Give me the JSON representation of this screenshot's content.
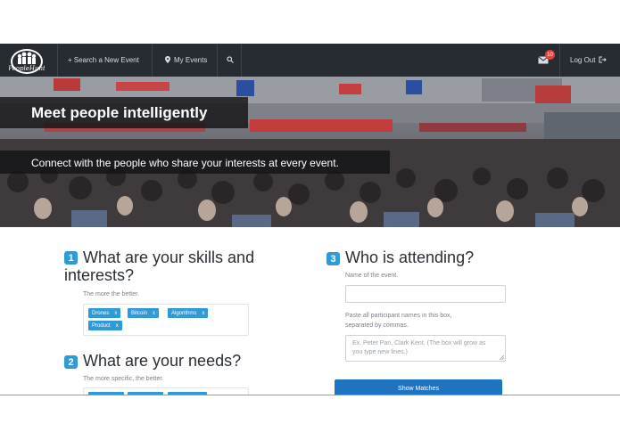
{
  "nav": {
    "logo_text": "PeopleHunt",
    "search_event": "+ Search a New Event",
    "my_events": "My Events",
    "mail_count": "10",
    "logout": "Log Out"
  },
  "hero": {
    "title": "Meet people intelligently",
    "subtitle": "Connect with the people who share your interests at every event."
  },
  "section1": {
    "number": "1",
    "title_line1": "What are your skills and",
    "title_line2": "interests?",
    "hint": "The more the better.",
    "tags": [
      "Drones",
      "Bitcoin",
      "Algorithms",
      "Product"
    ]
  },
  "section2": {
    "number": "2",
    "title": "What are your needs?",
    "hint": "The more specific, the better."
  },
  "section3": {
    "number": "3",
    "title": "Who is attending?",
    "event_label": "Name of the event.",
    "paste_label_line1": "Paste all participant names in this box,",
    "paste_label_line2": "separated by commas.",
    "placeholder_line1": "Ex. Peter Pan, Clark Kent. (The box will grow as",
    "placeholder_line2": "you type new lines.)",
    "button": "Show Matches"
  },
  "colors": {
    "navbar": "#272c33",
    "accent": "#2f9ad6",
    "button": "#1f74c2",
    "badge": "#e0403a"
  },
  "icons": {
    "location": "map-pin-icon",
    "search": "search-icon",
    "mail": "envelope-icon",
    "logout": "sign-out-icon",
    "tag_remove": "x"
  }
}
